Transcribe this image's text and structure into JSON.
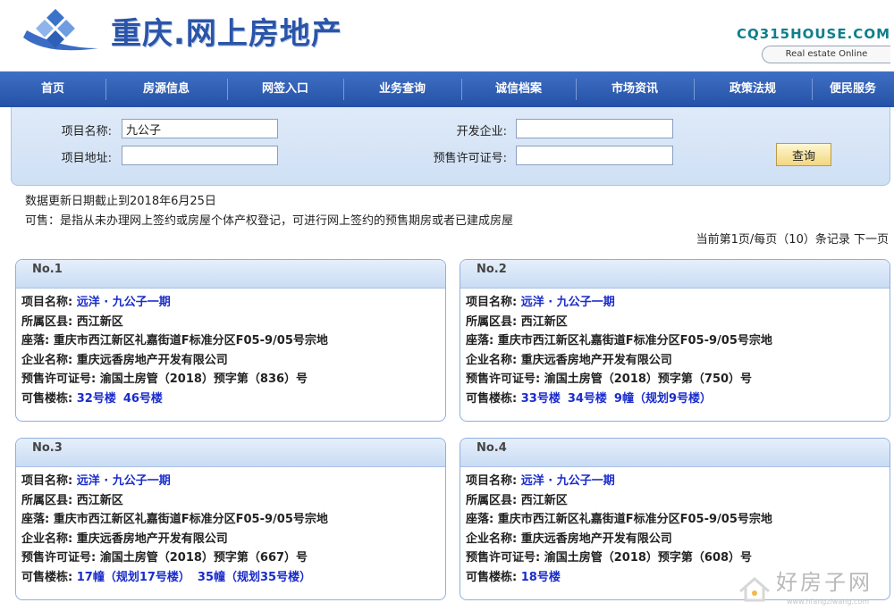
{
  "header": {
    "site_title": "重庆.网上房地产",
    "domain": "CQ315HOUSE.COM",
    "tagline": "Real estate Online"
  },
  "nav": {
    "items": [
      {
        "label": "首页"
      },
      {
        "label": "房源信息"
      },
      {
        "label": "网签入口"
      },
      {
        "label": "业务查询"
      },
      {
        "label": "诚信档案"
      },
      {
        "label": "市场资讯"
      },
      {
        "label": "政策法规"
      },
      {
        "label": "便民服务"
      }
    ]
  },
  "search": {
    "project_name_label": "项目名称:",
    "project_name_value": "九公子",
    "project_address_label": "项目地址:",
    "project_address_value": "",
    "developer_label": "开发企业:",
    "developer_value": "",
    "permit_label": "预售许可证号:",
    "permit_value": "",
    "query_button": "查询"
  },
  "info": {
    "update_date": "数据更新日期截止到2018年6月25日",
    "available_note": "可售：是指从未办理网上签约或房屋个体产权登记，可进行网上签约的预售期房或者已建成房屋",
    "pager_text": "当前第1页/每页（10）条记录",
    "next_page": "下一页"
  },
  "labels": {
    "project_name": "项目名称:",
    "district": "所属区县:",
    "location": "座落:",
    "company": "企业名称:",
    "permit": "预售许可证号:",
    "buildings": "可售楼栋:"
  },
  "cards": [
    {
      "no": "No.1",
      "project_name": "远洋 · 九公子一期",
      "district": "西江新区",
      "location": "重庆市西江新区礼嘉街道F标准分区F05-9/05号宗地",
      "company": "重庆远香房地产开发有限公司",
      "permit": "渝国土房管（2018）预字第（836）号",
      "buildings": [
        "32号楼",
        "46号楼"
      ]
    },
    {
      "no": "No.2",
      "project_name": "远洋 · 九公子一期",
      "district": "西江新区",
      "location": "重庆市西江新区礼嘉街道F标准分区F05-9/05号宗地",
      "company": "重庆远香房地产开发有限公司",
      "permit": "渝国土房管（2018）预字第（750）号",
      "buildings": [
        "33号楼",
        "34号楼",
        "9幢（规划9号楼）"
      ]
    },
    {
      "no": "No.3",
      "project_name": "远洋 · 九公子一期",
      "district": "西江新区",
      "location": "重庆市西江新区礼嘉街道F标准分区F05-9/05号宗地",
      "company": "重庆远香房地产开发有限公司",
      "permit": "渝国土房管（2018）预字第（667）号",
      "buildings": [
        "17幢（规划17号楼）",
        "35幢（规划35号楼）"
      ]
    },
    {
      "no": "No.4",
      "project_name": "远洋 · 九公子一期",
      "district": "西江新区",
      "location": "重庆市西江新区礼嘉街道F标准分区F05-9/05号宗地",
      "company": "重庆远香房地产开发有限公司",
      "permit": "渝国土房管（2018）预字第（608）号",
      "buildings": [
        "18号楼"
      ]
    }
  ],
  "watermark": {
    "text": "好房子网",
    "url": "www.hfangziwang.com"
  },
  "colors": {
    "nav_blue": "#2f5fb8",
    "title_blue": "#2a55a8",
    "link_blue": "#1a2ccc",
    "domain_teal": "#0f7f8c"
  }
}
